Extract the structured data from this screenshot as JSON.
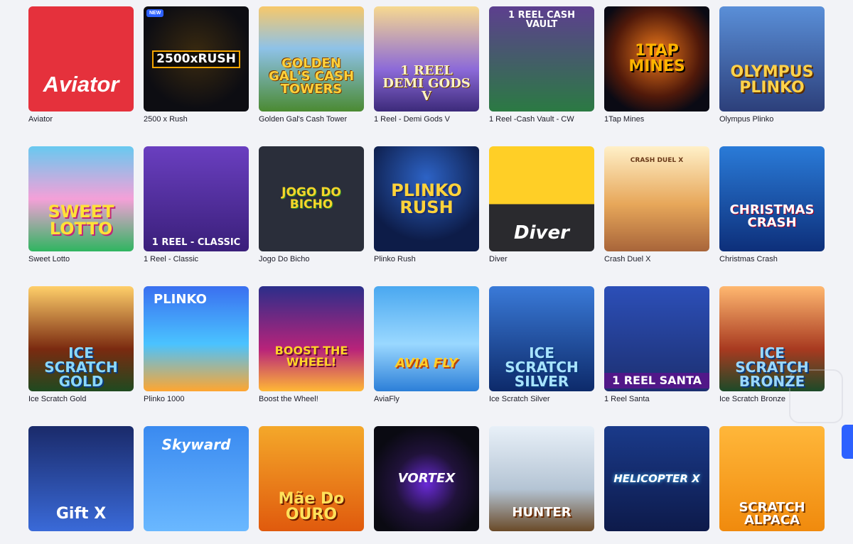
{
  "games": [
    {
      "name": "Aviator",
      "logo": "Aviator",
      "theme": "t-aviator",
      "badge": ""
    },
    {
      "name": "2500 x Rush",
      "logo": "2500xRUSH",
      "theme": "t-rush",
      "badge": "NEW"
    },
    {
      "name": "Golden Gal's Cash Tower",
      "logo": "GOLDEN GAL'S CASH TOWERS",
      "theme": "t-golden",
      "badge": ""
    },
    {
      "name": "1 Reel - Demi Gods V",
      "logo": "1 REEL DEMI GODS V",
      "theme": "t-demi",
      "badge": ""
    },
    {
      "name": "1 Reel -Cash Vault - CW",
      "logo": "1 REEL CASH VAULT",
      "theme": "t-vault",
      "badge": ""
    },
    {
      "name": "1Tap Mines",
      "logo": "1TAP MINES",
      "theme": "t-mines",
      "badge": ""
    },
    {
      "name": "Olympus Plinko",
      "logo": "OLYMPUS PLINKO",
      "theme": "t-olympus",
      "badge": ""
    },
    {
      "name": "Sweet Lotto",
      "logo": "SWEET LOTTO",
      "theme": "t-sweet",
      "badge": ""
    },
    {
      "name": "1 Reel - Classic",
      "logo": "1 REEL - CLASSIC",
      "theme": "t-classic",
      "badge": ""
    },
    {
      "name": "Jogo Do Bicho",
      "logo": "JOGO DO BICHO",
      "theme": "t-bicho",
      "badge": ""
    },
    {
      "name": "Plinko Rush",
      "logo": "PLINKO RUSH",
      "theme": "t-plinkorush",
      "badge": ""
    },
    {
      "name": "Diver",
      "logo": "Diver",
      "theme": "t-diver",
      "badge": ""
    },
    {
      "name": "Crash Duel X",
      "logo": "CRASH DUEL X",
      "theme": "t-crash",
      "badge": ""
    },
    {
      "name": "Christmas Crash",
      "logo": "CHRISTMAS CRASH",
      "theme": "t-xmas",
      "badge": ""
    },
    {
      "name": "Ice Scratch Gold",
      "logo": "ICE SCRATCH GOLD",
      "theme": "t-icegold",
      "badge": ""
    },
    {
      "name": "Plinko 1000",
      "logo": "PLINKO",
      "theme": "t-plinko1000",
      "badge": ""
    },
    {
      "name": "Boost the Wheel!",
      "logo": "BOOST THE WHEEL!",
      "theme": "t-boost",
      "badge": ""
    },
    {
      "name": "AviaFly",
      "logo": "AVIA FLY",
      "theme": "t-avia",
      "badge": ""
    },
    {
      "name": "Ice Scratch Silver",
      "logo": "ICE SCRATCH SILVER",
      "theme": "t-icesilver",
      "badge": ""
    },
    {
      "name": "1 Reel Santa",
      "logo": "1 REEL SANTA",
      "theme": "t-santa",
      "badge": ""
    },
    {
      "name": "Ice Scratch Bronze",
      "logo": "ICE SCRATCH BRONZE",
      "theme": "t-icebronze",
      "badge": ""
    },
    {
      "name": "",
      "logo": "Gift X",
      "theme": "t-gift",
      "badge": ""
    },
    {
      "name": "",
      "logo": "Skyward",
      "theme": "t-skyward",
      "badge": ""
    },
    {
      "name": "",
      "logo": "Mãe Do OURO",
      "theme": "t-maedo",
      "badge": ""
    },
    {
      "name": "",
      "logo": "VORTEX",
      "theme": "t-vortex",
      "badge": ""
    },
    {
      "name": "",
      "logo": "HUNTER",
      "theme": "t-hunter",
      "badge": ""
    },
    {
      "name": "",
      "logo": "HELICOPTER X",
      "theme": "t-heli",
      "badge": ""
    },
    {
      "name": "",
      "logo": "SCRATCH ALPACA",
      "theme": "t-alpaca",
      "badge": ""
    }
  ]
}
